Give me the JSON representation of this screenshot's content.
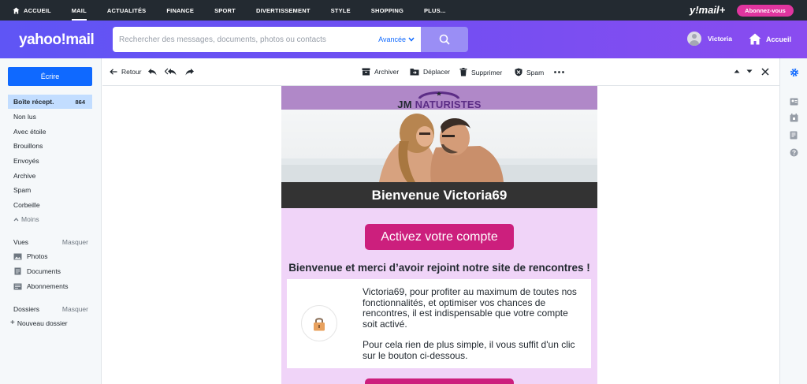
{
  "topnav": {
    "items": [
      {
        "label": "ACCUEIL"
      },
      {
        "label": "MAIL"
      },
      {
        "label": "ACTUALITÉS"
      },
      {
        "label": "FINANCE"
      },
      {
        "label": "SPORT"
      },
      {
        "label": "DIVERTISSEMENT"
      },
      {
        "label": "STYLE"
      },
      {
        "label": "SHOPPING"
      },
      {
        "label": "PLUS..."
      }
    ],
    "ymail_plus": "y!mail+",
    "subscribe": "Abonnez-vous"
  },
  "header": {
    "logo": "yahoo!mail",
    "search_placeholder": "Rechercher des messages, documents, photos ou contacts",
    "advanced": "Avancée",
    "user_name": "Victoria",
    "home": "Accueil"
  },
  "sidebar": {
    "compose": "Écrire",
    "folders": [
      {
        "label": "Boîte récept.",
        "count": "864"
      },
      {
        "label": "Non lus"
      },
      {
        "label": "Avec étoile"
      },
      {
        "label": "Brouillons"
      },
      {
        "label": "Envoyés"
      },
      {
        "label": "Archive"
      },
      {
        "label": "Spam"
      },
      {
        "label": "Corbeille"
      }
    ],
    "less": "Moins",
    "views_title": "Vues",
    "views_hide": "Masquer",
    "views": [
      {
        "label": "Photos",
        "icon": "photo-icon"
      },
      {
        "label": "Documents",
        "icon": "document-icon"
      },
      {
        "label": "Abonnements",
        "icon": "subscription-icon"
      }
    ],
    "folders_title": "Dossiers",
    "folders_hide": "Masquer",
    "new_folder": "Nouveau dossier"
  },
  "toolbar": {
    "back": "Retour",
    "archive": "Archiver",
    "move": "Déplacer",
    "delete": "Supprimer",
    "spam": "Spam"
  },
  "email": {
    "brand_part1": "JM ",
    "brand_part2": "NATURISTES",
    "welcome": "Bienvenue Victoria69",
    "activate": "Activez votre compte",
    "thanks": "Bienvenue et merci d’avoir rejoint notre site de rencontres !",
    "para1": "Victoria69, pour profiter au maximum de toutes nos fonctionnalités, et optimiser vos chances de rencontres, il est indispensable que votre compte soit activé.",
    "para2": "Pour cela rien de plus simple, il vous suffit d'un clic sur le bouton ci-dessous."
  },
  "colors": {
    "nav_bg": "#232a31",
    "header_gradient_start": "#5f55f5",
    "header_gradient_end": "#8a4cf0",
    "accent_blue": "#0f69ff",
    "selected_folder": "#c2ddff",
    "email_bg": "#f0d4f8",
    "email_button": "#cc1f7d",
    "brand_bar": "#b088c8"
  }
}
